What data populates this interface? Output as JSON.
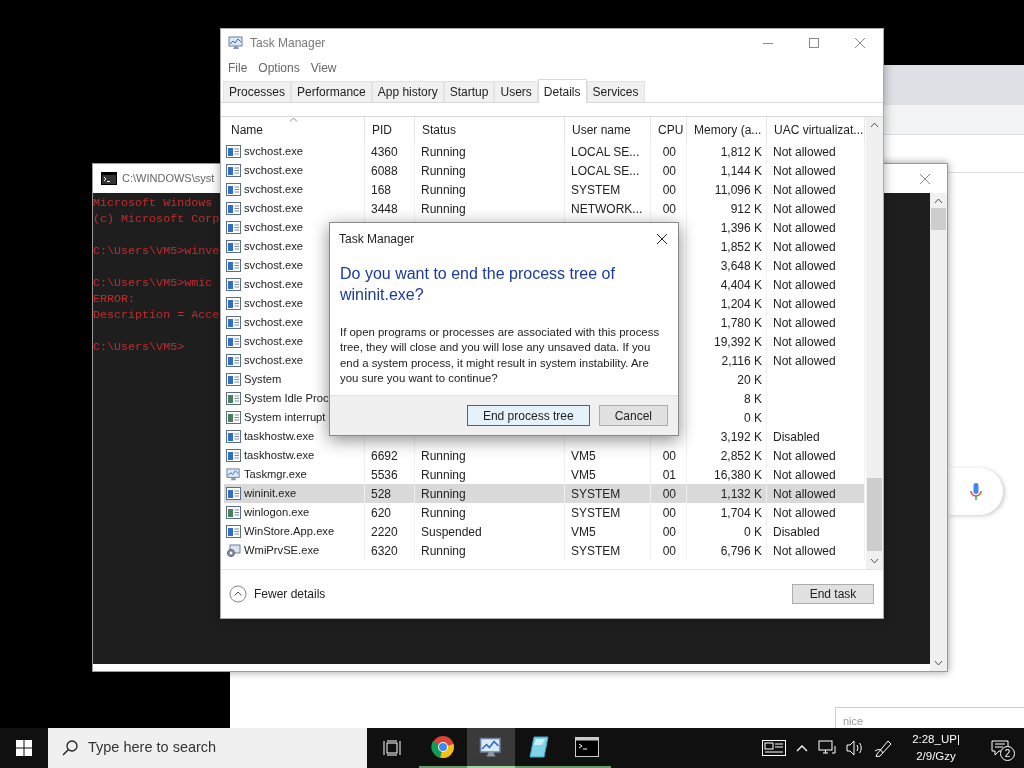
{
  "cmd_window": {
    "title": "C:\\WINDOWS\\syst",
    "blocks": [
      [
        "Microsoft Windows",
        "(c) Microsoft Corp"
      ],
      [
        "C:\\Users\\VM5>winve"
      ],
      [
        "C:\\Users\\VM5>wmic",
        "ERROR:",
        "Description = Acce"
      ],
      [
        "C:\\Users\\VM5>"
      ]
    ]
  },
  "browser": {
    "snippet": "nice"
  },
  "task_manager": {
    "title": "Task Manager",
    "menu": [
      "File",
      "Options",
      "View"
    ],
    "tabs": [
      {
        "label": "Processes",
        "selected": false
      },
      {
        "label": "Performance",
        "selected": false
      },
      {
        "label": "App history",
        "selected": false
      },
      {
        "label": "Startup",
        "selected": false
      },
      {
        "label": "Users",
        "selected": false
      },
      {
        "label": "Details",
        "selected": true
      },
      {
        "label": "Services",
        "selected": false
      }
    ],
    "columns": [
      {
        "label": "Name",
        "sorted": true
      },
      {
        "label": "PID",
        "sorted": false
      },
      {
        "label": "Status",
        "sorted": false
      },
      {
        "label": "User name",
        "sorted": false
      },
      {
        "label": "CPU",
        "sorted": false
      },
      {
        "label": "Memory (a...",
        "sorted": false
      },
      {
        "label": "UAC virtualizat...",
        "sorted": false
      }
    ],
    "rows": [
      {
        "kind": "service",
        "name": "svchost.exe",
        "pid": "4360",
        "status": "Running",
        "user": "LOCAL SE...",
        "cpu": "00",
        "memory": "1,812 K",
        "uac": "Not allowed",
        "selected": false
      },
      {
        "kind": "service",
        "name": "svchost.exe",
        "pid": "6088",
        "status": "Running",
        "user": "LOCAL SE...",
        "cpu": "00",
        "memory": "1,144 K",
        "uac": "Not allowed",
        "selected": false
      },
      {
        "kind": "service",
        "name": "svchost.exe",
        "pid": "168",
        "status": "Running",
        "user": "SYSTEM",
        "cpu": "00",
        "memory": "11,096 K",
        "uac": "Not allowed",
        "selected": false
      },
      {
        "kind": "service",
        "name": "svchost.exe",
        "pid": "3448",
        "status": "Running",
        "user": "NETWORK...",
        "cpu": "00",
        "memory": "912 K",
        "uac": "Not allowed",
        "selected": false
      },
      {
        "kind": "service",
        "name": "svchost.exe",
        "memory": "1,396 K",
        "uac": "Not allowed",
        "selected": false
      },
      {
        "kind": "service",
        "name": "svchost.exe",
        "memory": "1,852 K",
        "uac": "Not allowed",
        "selected": false
      },
      {
        "kind": "service",
        "name": "svchost.exe",
        "memory": "3,648 K",
        "uac": "Not allowed",
        "selected": false
      },
      {
        "kind": "service",
        "name": "svchost.exe",
        "memory": "4,404 K",
        "uac": "Not allowed",
        "selected": false
      },
      {
        "kind": "service",
        "name": "svchost.exe",
        "memory": "1,204 K",
        "uac": "Not allowed",
        "selected": false
      },
      {
        "kind": "service",
        "name": "svchost.exe",
        "memory": "1,780 K",
        "uac": "Not allowed",
        "selected": false
      },
      {
        "kind": "service",
        "name": "svchost.exe",
        "memory": "19,392 K",
        "uac": "Not allowed",
        "selected": false
      },
      {
        "kind": "service",
        "name": "svchost.exe",
        "memory": "2,116 K",
        "uac": "Not allowed",
        "selected": false
      },
      {
        "kind": "service",
        "name": "System",
        "memory": "20 K",
        "selected": false
      },
      {
        "kind": "system",
        "name": "System Idle Proc",
        "memory": "8 K",
        "selected": false
      },
      {
        "kind": "system",
        "name": "System interrupt",
        "memory": "0 K",
        "selected": false
      },
      {
        "kind": "service",
        "name": "taskhostw.exe",
        "memory": "3,192 K",
        "uac": "Disabled",
        "selected": false
      },
      {
        "kind": "service",
        "name": "taskhostw.exe",
        "pid": "6692",
        "status": "Running",
        "user": "VM5",
        "cpu": "00",
        "memory": "2,852 K",
        "uac": "Not allowed",
        "selected": false
      },
      {
        "kind": "monitor",
        "name": "Taskmgr.exe",
        "pid": "5536",
        "status": "Running",
        "user": "VM5",
        "cpu": "01",
        "memory": "16,380 K",
        "uac": "Not allowed",
        "selected": false
      },
      {
        "kind": "service",
        "name": "wininit.exe",
        "pid": "528",
        "status": "Running",
        "user": "SYSTEM",
        "cpu": "00",
        "memory": "1,132 K",
        "uac": "Not allowed",
        "selected": true
      },
      {
        "kind": "system",
        "name": "winlogon.exe",
        "pid": "620",
        "status": "Running",
        "user": "SYSTEM",
        "cpu": "00",
        "memory": "1,704 K",
        "uac": "Not allowed",
        "selected": false
      },
      {
        "kind": "service",
        "name": "WinStore.App.exe",
        "pid": "2220",
        "status": "Suspended",
        "user": "VM5",
        "cpu": "00",
        "memory": "0 K",
        "uac": "Disabled",
        "selected": false
      },
      {
        "kind": "gear",
        "name": "WmiPrvSE.exe",
        "pid": "6320",
        "status": "Running",
        "user": "SYSTEM",
        "cpu": "00",
        "memory": "6,796 K",
        "uac": "Not allowed",
        "selected": false
      }
    ],
    "footer": {
      "toggle": "Fewer details",
      "button": "End task"
    }
  },
  "dialog": {
    "title": "Task Manager",
    "heading": "Do you want to end the process tree of wininit.exe?",
    "message": "If open programs or processes are associated with this process tree, they will close and you will lose any unsaved data. If you end a system process, it might result in system instability. Are you sure you want to continue?",
    "buttons": [
      {
        "label": "End process tree",
        "default": true
      },
      {
        "label": "Cancel",
        "default": false
      }
    ]
  },
  "taskbar": {
    "search_placeholder": "Type here to search",
    "apps": [
      {
        "kind": "browser",
        "selected": false
      },
      {
        "kind": "monitor",
        "selected": true
      },
      {
        "kind": "glass",
        "selected": false
      },
      {
        "kind": "terminal",
        "selected": false
      }
    ],
    "time": "2:28_UP|",
    "date": "2/9/Gzy",
    "notifications": "2"
  }
}
